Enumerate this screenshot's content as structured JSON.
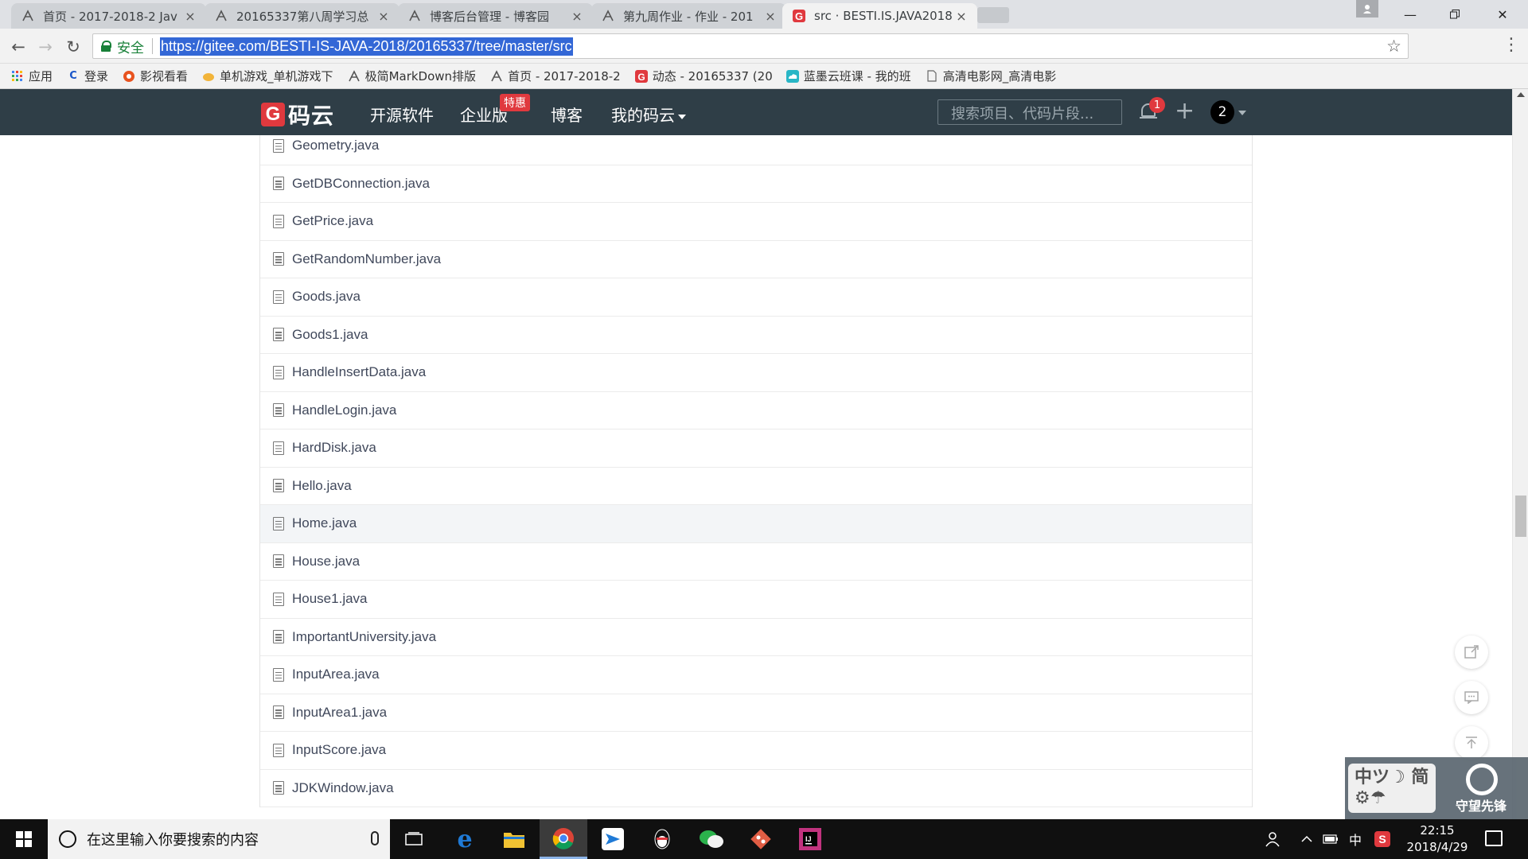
{
  "browser": {
    "tabs": [
      {
        "title": "首页 - 2017-2018-2 Jav",
        "icon": "cnblogs-icon",
        "active": false
      },
      {
        "title": "20165337第八周学习总",
        "icon": "cnblogs-icon",
        "active": false
      },
      {
        "title": "博客后台管理 - 博客园",
        "icon": "cnblogs-icon",
        "active": false
      },
      {
        "title": "第九周作业 - 作业 - 201",
        "icon": "cnblogs-icon",
        "active": false
      },
      {
        "title": "src · BESTI.IS.JAVA2018",
        "icon": "gitee-icon",
        "active": true
      }
    ],
    "close_glyph": "×",
    "security_label": "安全",
    "url": "https://gitee.com/BESTI-IS-JAVA-2018/20165337/tree/master/src",
    "bookmarks": [
      {
        "label": "应用",
        "icon": "apps-grid-icon"
      },
      {
        "label": "登录",
        "icon": "c-letter-icon"
      },
      {
        "label": "影视看看",
        "icon": "video-icon"
      },
      {
        "label": "单机游戏_单机游戏下",
        "icon": "game-icon"
      },
      {
        "label": "极简MarkDown排版",
        "icon": "cnblogs-icon"
      },
      {
        "label": "首页 - 2017-2018-2",
        "icon": "cnblogs-icon"
      },
      {
        "label": "动态 - 20165337 (20",
        "icon": "gitee-icon"
      },
      {
        "label": "蓝墨云班课 - 我的班",
        "icon": "cloud-icon"
      },
      {
        "label": "高清电影网_高清电影",
        "icon": "page-icon"
      }
    ]
  },
  "gitee": {
    "logo_letter": "G",
    "logo_text": "码云",
    "nav": {
      "open_source": "开源软件",
      "enterprise": "企业版",
      "special_badge": "特惠",
      "blog": "博客",
      "my_gitee": "我的码云"
    },
    "search_placeholder": "搜索项目、代码片段...",
    "notification_count": "1",
    "plus_glyph": "+",
    "avatar_text": "2"
  },
  "files": [
    "Geometry.java",
    "GetDBConnection.java",
    "GetPrice.java",
    "GetRandomNumber.java",
    "Goods.java",
    "Goods1.java",
    "HandleInsertData.java",
    "HandleLogin.java",
    "HardDisk.java",
    "Hello.java",
    "Home.java",
    "House.java",
    "House1.java",
    "ImportantUniversity.java",
    "InputArea.java",
    "InputArea1.java",
    "InputScore.java",
    "JDKWindow.java"
  ],
  "hovered_file": "Home.java",
  "watermark": {
    "box_text": "中ツ☽ 简⚙☂",
    "text": "守望先锋"
  },
  "taskbar": {
    "search_placeholder": "在这里输入你要搜索的内容",
    "ime_label": "中",
    "time": "22:15",
    "date": "2018/4/29",
    "apps": [
      {
        "name": "task-view",
        "color": "#101010"
      },
      {
        "name": "edge",
        "color": "#1f7ad6"
      },
      {
        "name": "file-explorer",
        "color": "#f1c232"
      },
      {
        "name": "chrome",
        "color": "#e3463b"
      },
      {
        "name": "mail",
        "color": "#1f7ad6"
      },
      {
        "name": "qq",
        "color": "#101010"
      },
      {
        "name": "wechat",
        "color": "#2bb24c"
      },
      {
        "name": "git",
        "color": "#e05d44"
      },
      {
        "name": "intellij",
        "color": "#c1337e"
      }
    ]
  }
}
